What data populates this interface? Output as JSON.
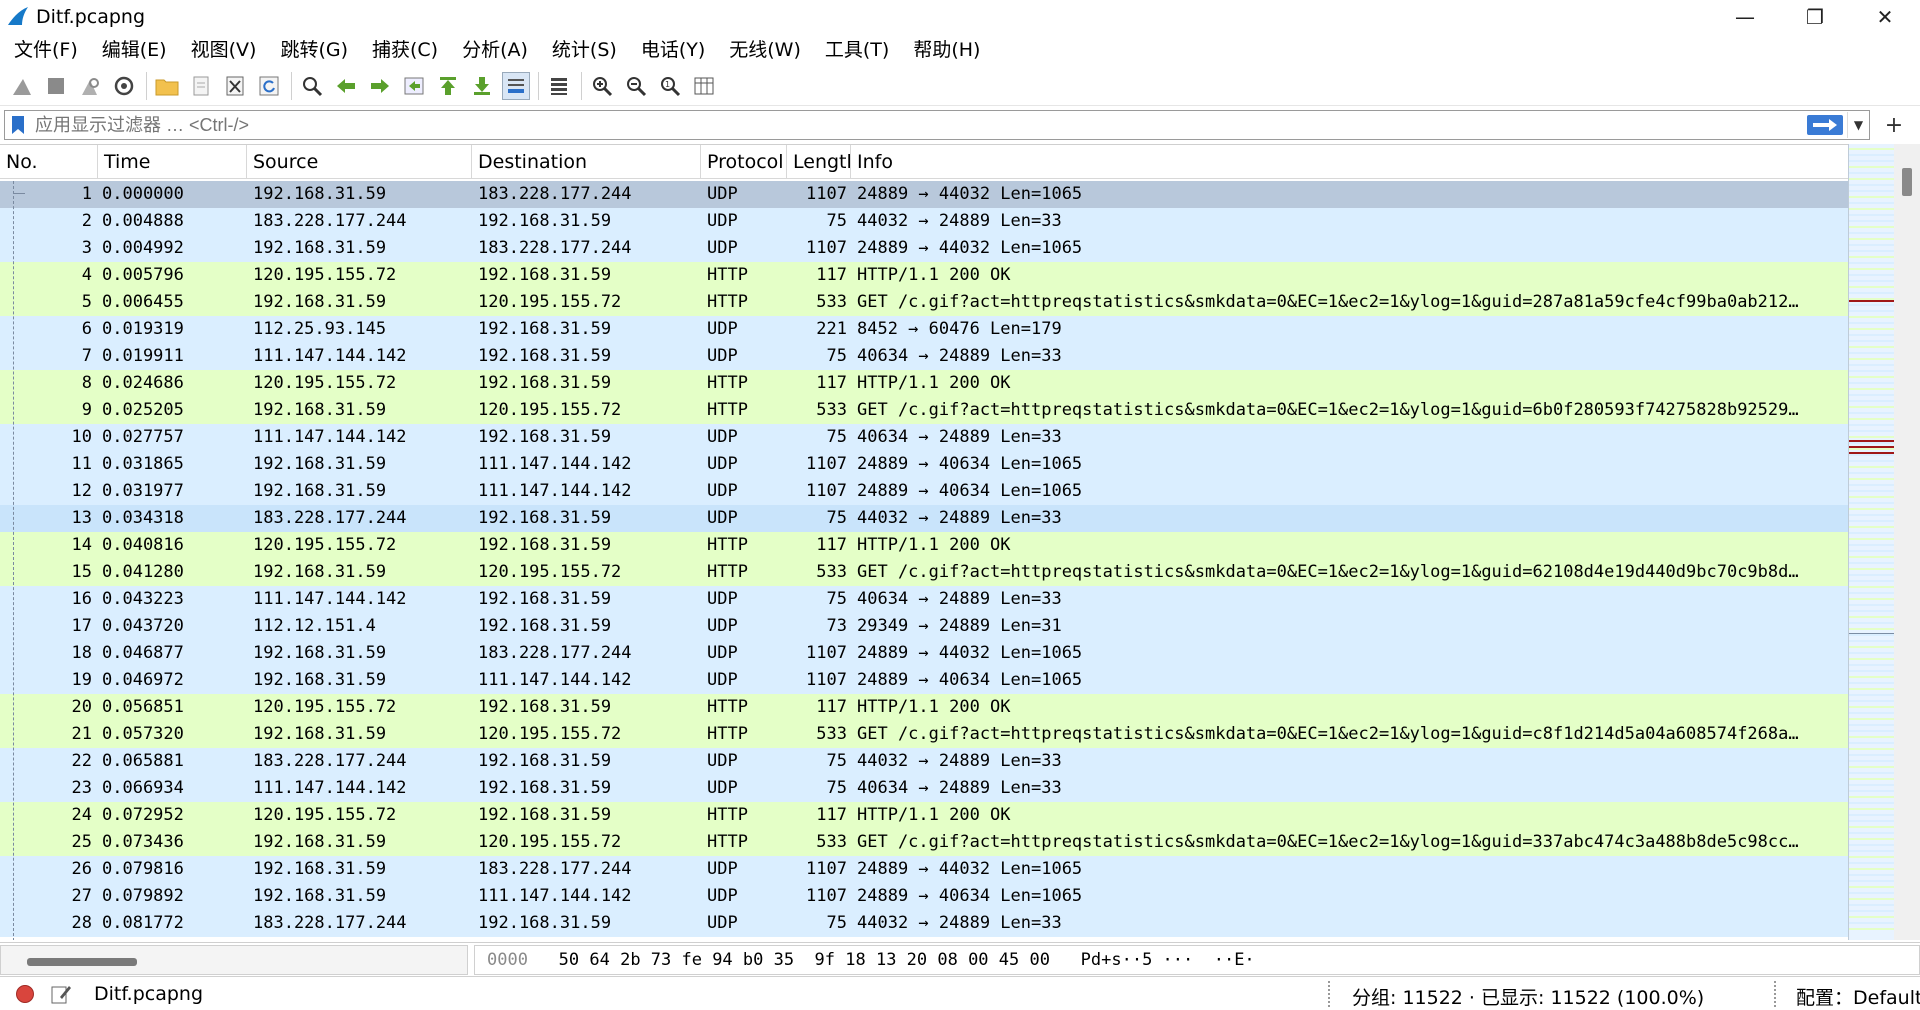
{
  "window": {
    "title": "Ditf.pcapng",
    "minimize": "—",
    "maximize": "❐",
    "close": "✕"
  },
  "menu": [
    "文件(F)",
    "编辑(E)",
    "视图(V)",
    "跳转(G)",
    "捕获(C)",
    "分析(A)",
    "统计(S)",
    "电话(Y)",
    "无线(W)",
    "工具(T)",
    "帮助(H)"
  ],
  "filter": {
    "placeholder": "应用显示过滤器 … <Ctrl-/>",
    "value": "",
    "plus": "+"
  },
  "columns": [
    "No.",
    "Time",
    "Source",
    "Destination",
    "Protocol",
    "Lengtl",
    "Info"
  ],
  "packets": [
    {
      "no": "1",
      "time": "0.000000",
      "src": "192.168.31.59",
      "dst": "183.228.177.244",
      "proto": "UDP",
      "len": "1107",
      "info": "24889 → 44032 Len=1065",
      "kind": "selected"
    },
    {
      "no": "2",
      "time": "0.004888",
      "src": "183.228.177.244",
      "dst": "192.168.31.59",
      "proto": "UDP",
      "len": "75",
      "info": "44032 → 24889 Len=33",
      "kind": "udp"
    },
    {
      "no": "3",
      "time": "0.004992",
      "src": "192.168.31.59",
      "dst": "183.228.177.244",
      "proto": "UDP",
      "len": "1107",
      "info": "24889 → 44032 Len=1065",
      "kind": "udp"
    },
    {
      "no": "4",
      "time": "0.005796",
      "src": "120.195.155.72",
      "dst": "192.168.31.59",
      "proto": "HTTP",
      "len": "117",
      "info": "HTTP/1.1 200 OK",
      "kind": "http"
    },
    {
      "no": "5",
      "time": "0.006455",
      "src": "192.168.31.59",
      "dst": "120.195.155.72",
      "proto": "HTTP",
      "len": "533",
      "info": "GET /c.gif?act=httpreqstatistics&smkdata=0&EC=1&ec2=1&ylog=1&guid=287a81a59cfe4cf99ba0ab212…",
      "kind": "http"
    },
    {
      "no": "6",
      "time": "0.019319",
      "src": "112.25.93.145",
      "dst": "192.168.31.59",
      "proto": "UDP",
      "len": "221",
      "info": "8452 → 60476 Len=179",
      "kind": "udp"
    },
    {
      "no": "7",
      "time": "0.019911",
      "src": "111.147.144.142",
      "dst": "192.168.31.59",
      "proto": "UDP",
      "len": "75",
      "info": "40634 → 24889 Len=33",
      "kind": "udp"
    },
    {
      "no": "8",
      "time": "0.024686",
      "src": "120.195.155.72",
      "dst": "192.168.31.59",
      "proto": "HTTP",
      "len": "117",
      "info": "HTTP/1.1 200 OK",
      "kind": "http"
    },
    {
      "no": "9",
      "time": "0.025205",
      "src": "192.168.31.59",
      "dst": "120.195.155.72",
      "proto": "HTTP",
      "len": "533",
      "info": "GET /c.gif?act=httpreqstatistics&smkdata=0&EC=1&ec2=1&ylog=1&guid=6b0f280593f74275828b92529…",
      "kind": "http"
    },
    {
      "no": "10",
      "time": "0.027757",
      "src": "111.147.144.142",
      "dst": "192.168.31.59",
      "proto": "UDP",
      "len": "75",
      "info": "40634 → 24889 Len=33",
      "kind": "udp"
    },
    {
      "no": "11",
      "time": "0.031865",
      "src": "192.168.31.59",
      "dst": "111.147.144.142",
      "proto": "UDP",
      "len": "1107",
      "info": "24889 → 40634 Len=1065",
      "kind": "udp"
    },
    {
      "no": "12",
      "time": "0.031977",
      "src": "192.168.31.59",
      "dst": "111.147.144.142",
      "proto": "UDP",
      "len": "1107",
      "info": "24889 → 40634 Len=1065",
      "kind": "udp"
    },
    {
      "no": "13",
      "time": "0.034318",
      "src": "183.228.177.244",
      "dst": "192.168.31.59",
      "proto": "UDP",
      "len": "75",
      "info": "44032 → 24889 Len=33",
      "kind": "alt-udp"
    },
    {
      "no": "14",
      "time": "0.040816",
      "src": "120.195.155.72",
      "dst": "192.168.31.59",
      "proto": "HTTP",
      "len": "117",
      "info": "HTTP/1.1 200 OK",
      "kind": "http"
    },
    {
      "no": "15",
      "time": "0.041280",
      "src": "192.168.31.59",
      "dst": "120.195.155.72",
      "proto": "HTTP",
      "len": "533",
      "info": "GET /c.gif?act=httpreqstatistics&smkdata=0&EC=1&ec2=1&ylog=1&guid=62108d4e19d440d9bc70c9b8d…",
      "kind": "http"
    },
    {
      "no": "16",
      "time": "0.043223",
      "src": "111.147.144.142",
      "dst": "192.168.31.59",
      "proto": "UDP",
      "len": "75",
      "info": "40634 → 24889 Len=33",
      "kind": "udp"
    },
    {
      "no": "17",
      "time": "0.043720",
      "src": "112.12.151.4",
      "dst": "192.168.31.59",
      "proto": "UDP",
      "len": "73",
      "info": "29349 → 24889 Len=31",
      "kind": "udp"
    },
    {
      "no": "18",
      "time": "0.046877",
      "src": "192.168.31.59",
      "dst": "183.228.177.244",
      "proto": "UDP",
      "len": "1107",
      "info": "24889 → 44032 Len=1065",
      "kind": "udp"
    },
    {
      "no": "19",
      "time": "0.046972",
      "src": "192.168.31.59",
      "dst": "111.147.144.142",
      "proto": "UDP",
      "len": "1107",
      "info": "24889 → 40634 Len=1065",
      "kind": "udp"
    },
    {
      "no": "20",
      "time": "0.056851",
      "src": "120.195.155.72",
      "dst": "192.168.31.59",
      "proto": "HTTP",
      "len": "117",
      "info": "HTTP/1.1 200 OK",
      "kind": "http"
    },
    {
      "no": "21",
      "time": "0.057320",
      "src": "192.168.31.59",
      "dst": "120.195.155.72",
      "proto": "HTTP",
      "len": "533",
      "info": "GET /c.gif?act=httpreqstatistics&smkdata=0&EC=1&ec2=1&ylog=1&guid=c8f1d214d5a04a608574f268a…",
      "kind": "http"
    },
    {
      "no": "22",
      "time": "0.065881",
      "src": "183.228.177.244",
      "dst": "192.168.31.59",
      "proto": "UDP",
      "len": "75",
      "info": "44032 → 24889 Len=33",
      "kind": "udp"
    },
    {
      "no": "23",
      "time": "0.066934",
      "src": "111.147.144.142",
      "dst": "192.168.31.59",
      "proto": "UDP",
      "len": "75",
      "info": "40634 → 24889 Len=33",
      "kind": "udp"
    },
    {
      "no": "24",
      "time": "0.072952",
      "src": "120.195.155.72",
      "dst": "192.168.31.59",
      "proto": "HTTP",
      "len": "117",
      "info": "HTTP/1.1 200 OK",
      "kind": "http"
    },
    {
      "no": "25",
      "time": "0.073436",
      "src": "192.168.31.59",
      "dst": "120.195.155.72",
      "proto": "HTTP",
      "len": "533",
      "info": "GET /c.gif?act=httpreqstatistics&smkdata=0&EC=1&ec2=1&ylog=1&guid=337abc474c3a488b8de5c98cc…",
      "kind": "http"
    },
    {
      "no": "26",
      "time": "0.079816",
      "src": "192.168.31.59",
      "dst": "183.228.177.244",
      "proto": "UDP",
      "len": "1107",
      "info": "24889 → 44032 Len=1065",
      "kind": "udp"
    },
    {
      "no": "27",
      "time": "0.079892",
      "src": "192.168.31.59",
      "dst": "111.147.144.142",
      "proto": "UDP",
      "len": "1107",
      "info": "24889 → 40634 Len=1065",
      "kind": "udp"
    },
    {
      "no": "28",
      "time": "0.081772",
      "src": "183.228.177.244",
      "dst": "192.168.31.59",
      "proto": "UDP",
      "len": "75",
      "info": "44032 → 24889 Len=33",
      "kind": "udp"
    }
  ],
  "hex": {
    "offset": "0000",
    "bytes": "50 64 2b 73 fe 94 b0 35  9f 18 13 20 08 00 45 00",
    "ascii": "Pd+s··5 ···  ··E·"
  },
  "status": {
    "file": "Ditf.pcapng",
    "packets": "分组: 11522 · 已显示: 11522 (100.0%)",
    "profile": "配置：Default"
  },
  "colors": {
    "udp_row": "#daeeff",
    "http_row": "#e4ffc7",
    "selected_row": "#b8c8db",
    "accent": "#3a7bd5",
    "record_dot": "#d9453d"
  },
  "icons": {
    "toolbar": [
      "shark-fin-start-icon",
      "stop-capture-icon",
      "restart-capture-icon",
      "capture-options-icon",
      "open-file-icon",
      "file-set-icon",
      "close-file-icon",
      "reload-icon",
      "find-packet-icon",
      "go-back-icon",
      "go-forward-icon",
      "go-to-packet-icon",
      "first-packet-icon",
      "last-packet-icon",
      "auto-scroll-icon",
      "colorize-icon",
      "zoom-in-icon",
      "zoom-out-icon",
      "normal-size-icon",
      "resize-columns-icon"
    ]
  }
}
